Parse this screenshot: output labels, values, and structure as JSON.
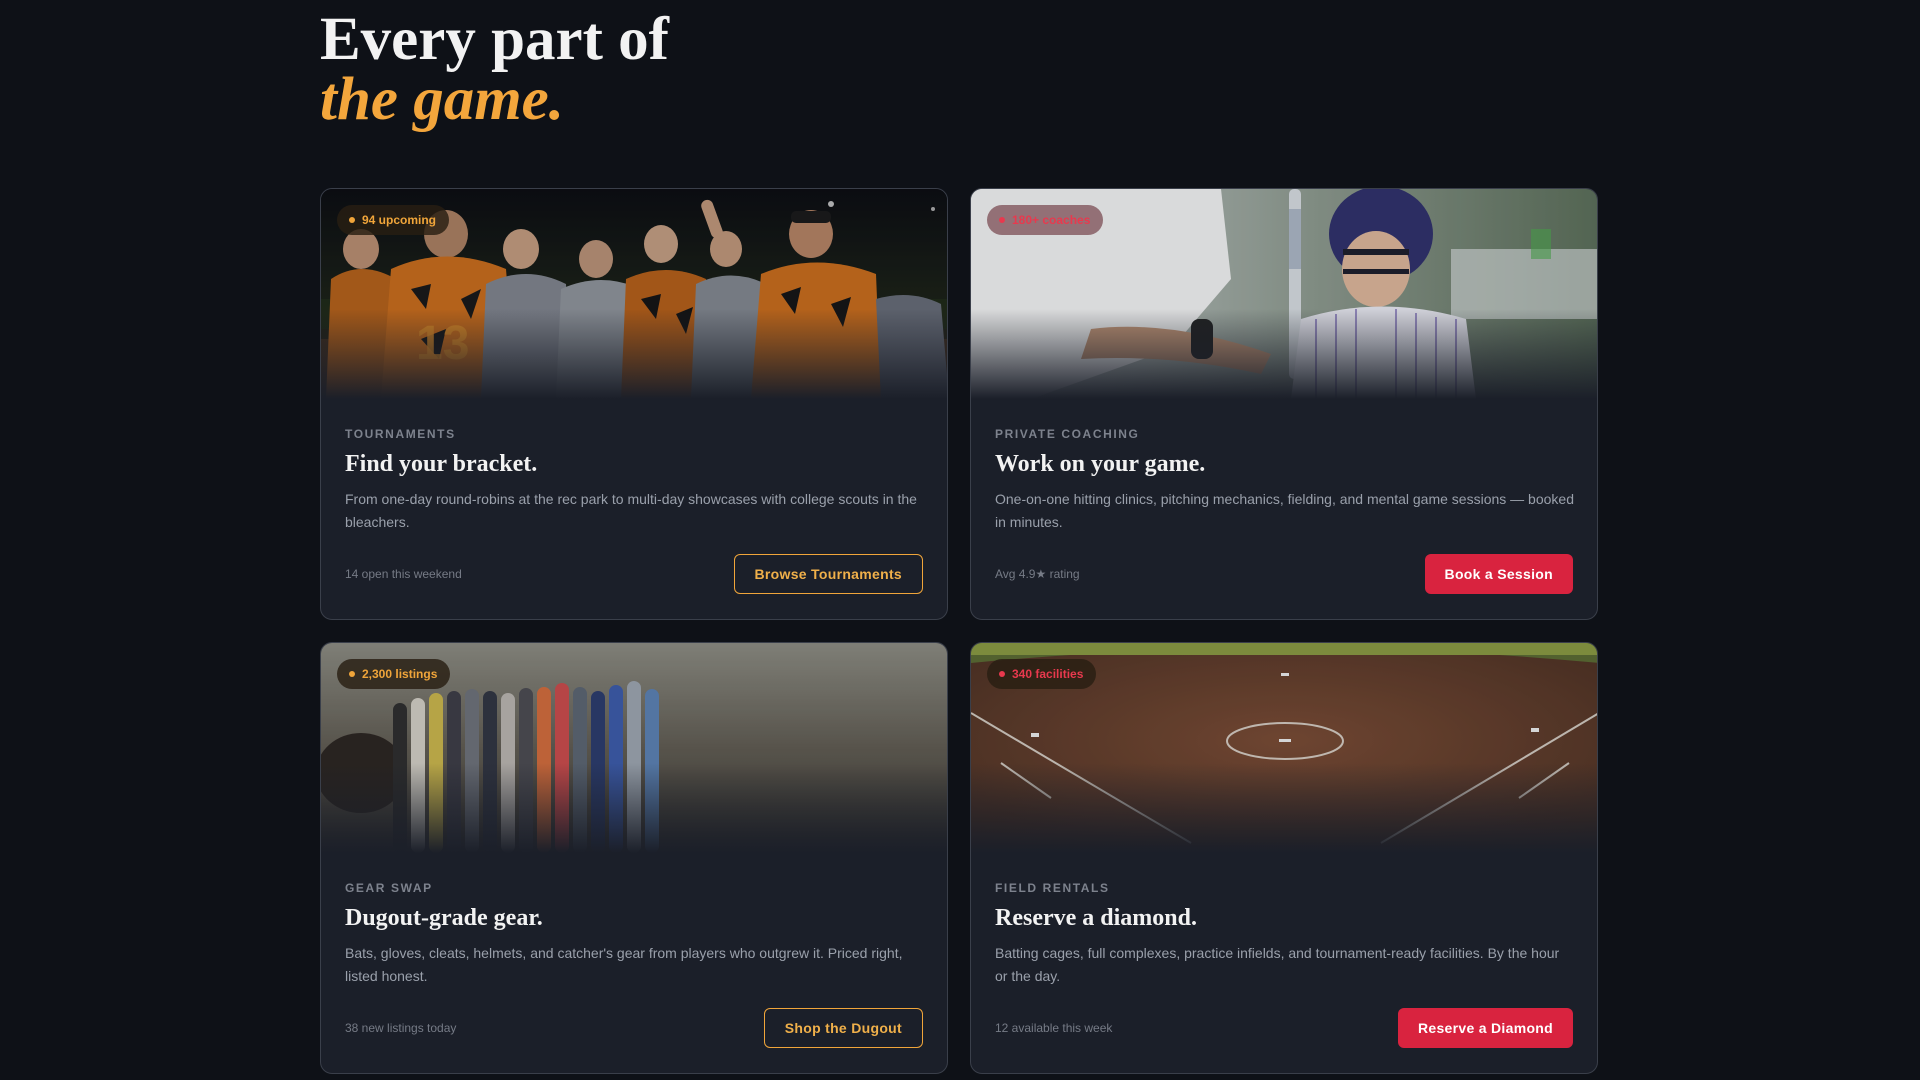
{
  "hero": {
    "line1": "Every part of",
    "line2": "the game."
  },
  "colors": {
    "accent_amber": "#f0a53a",
    "accent_red": "#d9233f",
    "background": "#0e1117",
    "card": "#1b1f29"
  },
  "cards": [
    {
      "badge": "94 upcoming",
      "category": "TOURNAMENTS",
      "title": "Find your bracket.",
      "description": "From one-day round-robins at the rec park to multi-day showcases with college scouts in the bleachers.",
      "meta": "14 open this weekend",
      "button": "Browse Tournaments"
    },
    {
      "badge": "180+ coaches",
      "category": "PRIVATE COACHING",
      "title": "Work on your game.",
      "description": "One-on-one hitting clinics, pitching mechanics, fielding, and mental game sessions — booked in minutes.",
      "meta": "Avg 4.9★ rating",
      "button": "Book a Session"
    },
    {
      "badge": "2,300 listings",
      "category": "GEAR SWAP",
      "title": "Dugout-grade gear.",
      "description": "Bats, gloves, cleats, helmets, and catcher's gear from players who outgrew it. Priced right, listed honest.",
      "meta": "38 new listings today",
      "button": "Shop the Dugout"
    },
    {
      "badge": "340 facilities",
      "category": "FIELD RENTALS",
      "title": "Reserve a diamond.",
      "description": "Batting cages, full complexes, practice infields, and tournament-ready facilities. By the hour or the day.",
      "meta": "12 available this week",
      "button": "Reserve a Diamond"
    }
  ]
}
